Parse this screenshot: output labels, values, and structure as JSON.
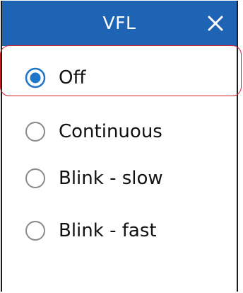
{
  "dialog": {
    "title": "VFL",
    "close_icon": "close-icon"
  },
  "options": [
    {
      "label": "Off",
      "selected": true
    },
    {
      "label": "Continuous",
      "selected": false
    },
    {
      "label": "Blink - slow",
      "selected": false
    },
    {
      "label": "Blink - fast",
      "selected": false
    }
  ],
  "colors": {
    "header": "#1f63b4",
    "radio_selected": "#1f76c9",
    "radio_unselected": "#8a8a8a",
    "highlight": "#d2232a"
  }
}
